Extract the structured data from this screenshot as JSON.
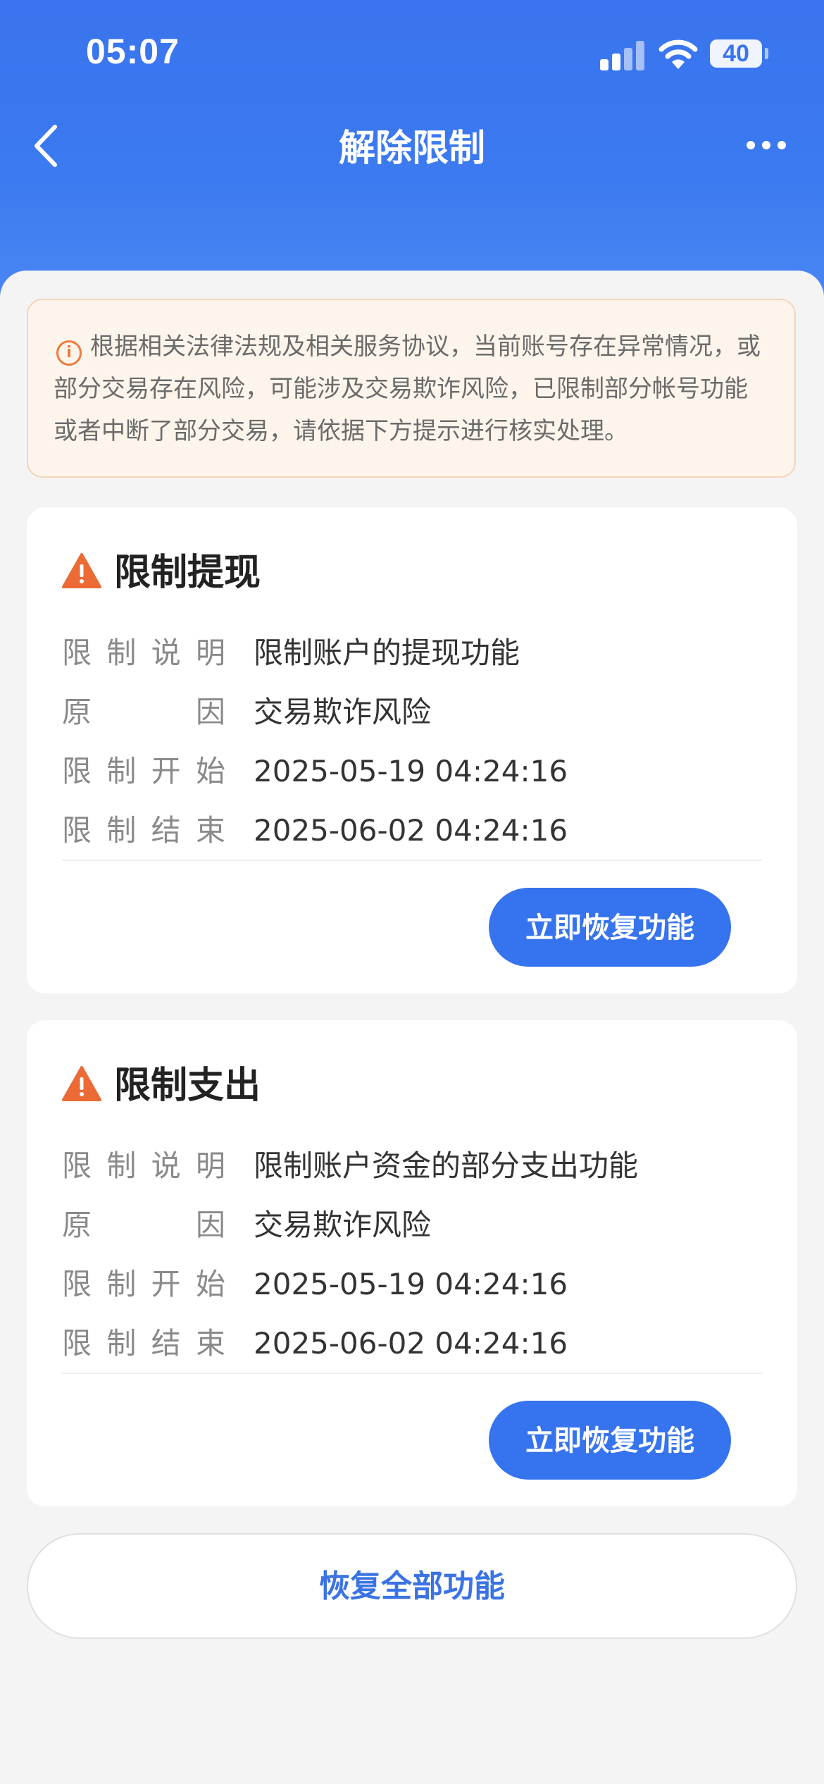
{
  "status_bar": {
    "time": "05:07",
    "battery": "40"
  },
  "header": {
    "title": "解除限制"
  },
  "notice": {
    "text": "根据相关法律法规及相关服务协议，当前账号存在异常情况，或部分交易存在风险，可能涉及交易欺诈风险，已限制部分帐号功能或者中断了部分交易，请依据下方提示进行核实处理。"
  },
  "cards": [
    {
      "title": "限制提现",
      "rows": [
        {
          "label": [
            "限",
            "制",
            "说",
            "明"
          ],
          "value": "限制账户的提现功能"
        },
        {
          "label": [
            "原",
            "因"
          ],
          "value": "交易欺诈风险"
        },
        {
          "label": [
            "限",
            "制",
            "开",
            "始"
          ],
          "value": "2025-05-19 04:24:16"
        },
        {
          "label": [
            "限",
            "制",
            "结",
            "束"
          ],
          "value": "2025-06-02 04:24:16"
        }
      ],
      "button": "立即恢复功能"
    },
    {
      "title": "限制支出",
      "rows": [
        {
          "label": [
            "限",
            "制",
            "说",
            "明"
          ],
          "value": "限制账户资金的部分支出功能"
        },
        {
          "label": [
            "原",
            "因"
          ],
          "value": "交易欺诈风险"
        },
        {
          "label": [
            "限",
            "制",
            "开",
            "始"
          ],
          "value": "2025-05-19 04:24:16"
        },
        {
          "label": [
            "限",
            "制",
            "结",
            "束"
          ],
          "value": "2025-06-02 04:24:16"
        }
      ],
      "button": "立即恢复功能"
    }
  ],
  "restore_all": "恢复全部功能",
  "colors": {
    "header_blue": "#3a74ee",
    "button_blue": "#3673ee",
    "warning_orange": "#ec6a35"
  }
}
